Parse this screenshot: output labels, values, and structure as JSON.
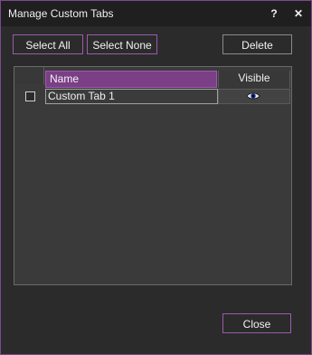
{
  "dialog": {
    "title": "Manage Custom Tabs",
    "help_glyph": "?",
    "close_glyph": "✕"
  },
  "toolbar": {
    "select_all_label": "Select All",
    "select_none_label": "Select None",
    "delete_label": "Delete"
  },
  "table": {
    "columns": [
      "Name",
      "Visible"
    ],
    "rows": [
      {
        "name": "Custom Tab 1",
        "checked": false,
        "visible_icon": "eye-icon"
      }
    ]
  },
  "footer": {
    "close_label": "Close"
  },
  "colors": {
    "accent": "#9b5aae",
    "header_fill": "#7b3f86",
    "background": "#2b2b2b"
  }
}
